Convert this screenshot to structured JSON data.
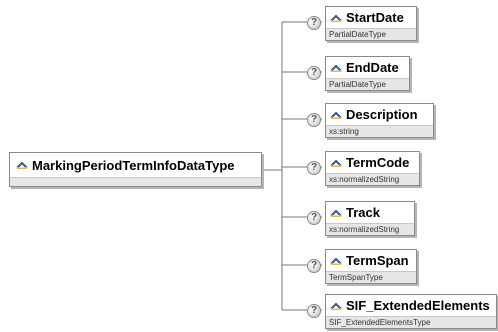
{
  "root": {
    "name": "MarkingPeriodTermInfoDataType",
    "icon": "element-type-icon"
  },
  "sequence_icon": "question-mark-icon",
  "elements": [
    {
      "id": "startdate",
      "name": "StartDate",
      "type": "PartialDateType",
      "icon": "element-icon"
    },
    {
      "id": "enddate",
      "name": "EndDate",
      "type": "PartialDateType",
      "icon": "element-icon"
    },
    {
      "id": "description",
      "name": "Description",
      "type": "xs:string",
      "icon": "element-icon"
    },
    {
      "id": "termcode",
      "name": "TermCode",
      "type": "xs:normalizedString",
      "icon": "element-icon"
    },
    {
      "id": "track",
      "name": "Track",
      "type": "xs:normalizedString",
      "icon": "element-icon"
    },
    {
      "id": "termspan",
      "name": "TermSpan",
      "type": "TermSpanType",
      "icon": "element-icon"
    },
    {
      "id": "sif-extendedelements",
      "name": "SIF_ExtendedElements",
      "type": "SIF_ExtendedElementsType",
      "icon": "element-icon"
    }
  ]
}
